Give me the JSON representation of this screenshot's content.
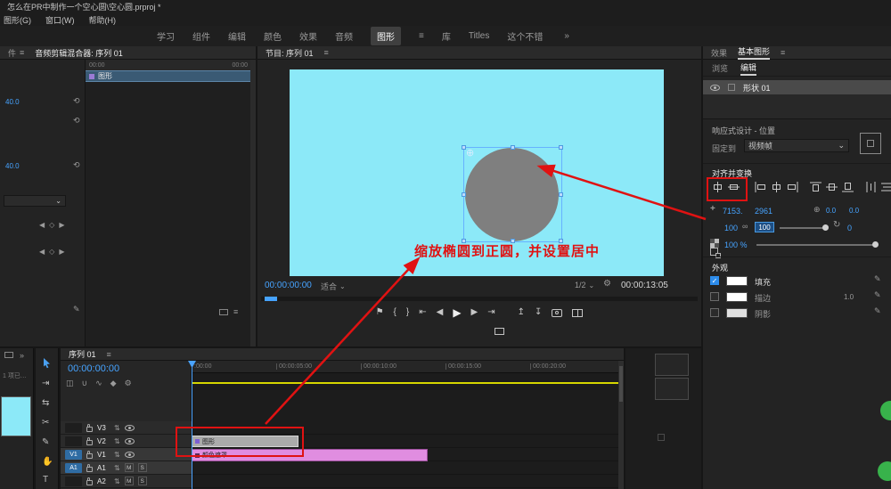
{
  "title_bar": {
    "title": "怎么在PR中制作一个空心圆\\空心圆.prproj *"
  },
  "menu_bar": {
    "items": [
      "图形(G)",
      "窗口(W)",
      "帮助(H)"
    ]
  },
  "workspace": {
    "tabs": [
      "学习",
      "组件",
      "编辑",
      "颜色",
      "效果",
      "音频",
      "图形",
      "库",
      "Titles",
      "这个不错"
    ],
    "active_tab": "图形"
  },
  "left_panel": {
    "tab_partial": "件",
    "tab_title": "音频剪辑混合器: 序列 01",
    "ruler_start": "00:00",
    "ruler_end": "00:00",
    "clip_name": "图形",
    "param_value_1": "40.0",
    "param_value_2": "40.0"
  },
  "program_monitor": {
    "tab_title": "节目: 序列 01",
    "annotation": "缩放椭圆到正圆，并设置居中",
    "current_timecode": "00:00:00:00",
    "zoom_level": "适合",
    "playback_resolution": "1/2",
    "out_timecode": "00:00:13:05"
  },
  "graphics_panel": {
    "tab_effects": "效果",
    "tab_essential": "基本图形",
    "subtab_browse": "浏览",
    "subtab_edit": "编辑",
    "layer_name": "形状 01",
    "responsive_title": "响应式设计 - 位置",
    "pin_to_label": "固定到",
    "pin_to_value": "视频帧",
    "align_title": "对齐并变换",
    "position_x": "7153.",
    "position_y": "2961",
    "anchor_x": "0.0",
    "anchor_y": "0.0",
    "scale_value": "100",
    "scale_field": "100",
    "rotation_value": "0",
    "opacity_value": "100 %",
    "appearance_title": "外观",
    "fill_label": "填充",
    "stroke_label": "描边",
    "stroke_width": "1.0",
    "shadow_label": "阴影"
  },
  "project_panel": {
    "status": "1 项已…"
  },
  "timeline": {
    "tab_title": "序列 01",
    "timecode": "00:00:00:00",
    "ruler_labels": [
      ":00:00",
      "00:00:05:00",
      "00:00:10:00",
      "00:00:15:00",
      "00:00:20:00"
    ],
    "tracks": [
      {
        "patch": "",
        "label": "V3"
      },
      {
        "patch": "",
        "label": "V2"
      },
      {
        "patch": "V1",
        "label": "V1"
      },
      {
        "patch": "A1",
        "label": "A1"
      },
      {
        "patch": "",
        "label": "A2"
      }
    ],
    "mute_label": "M",
    "solo_label": "S",
    "clip_graphic": "图形",
    "clip_matte": "颜色遮罩"
  },
  "icons": {
    "panel_menu": "≡",
    "caret_down": "⌄",
    "overflow_right": "»",
    "reset": "⟲",
    "pencil": "✎",
    "check": "✓",
    "key_prev": "◀",
    "key_diamond": "◇",
    "key_next": "▶",
    "marker": "⚑",
    "mark_in": "{",
    "mark_out": "}",
    "go_to_in": "⇤",
    "step_back": "◀",
    "play": "▶",
    "step_forward": "▶",
    "go_to_out": "⇥",
    "lift": "↥",
    "extract": "↧",
    "settings_gear": "⚙",
    "position_cross": "+",
    "anchor": "⊕",
    "link": "∞",
    "rotate": "↻",
    "nest": "◫",
    "snap": "∪",
    "linked_selection": "∿",
    "add_marker": "◆",
    "sync_lock": "⇅",
    "track_select": "⇥",
    "ripple_edit": "⇆",
    "razor": "✂",
    "pen": "✎",
    "hand": "✋",
    "type_tool": "T"
  },
  "colors": {
    "accent": "#2d8ceb",
    "timecode_blue": "#46a3ff",
    "viewport_cyan": "#8ce9f8",
    "annotation_red": "#e01212",
    "clip_pink": "#e08de0",
    "work_bar_yellow": "#d6d600"
  }
}
